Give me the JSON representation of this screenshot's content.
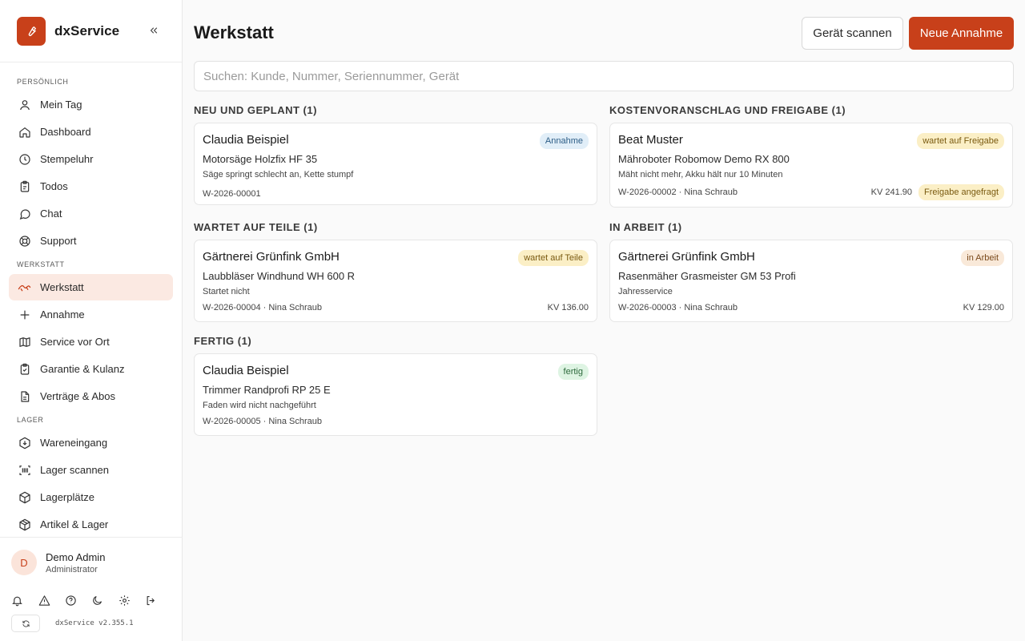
{
  "app": {
    "name": "dxService",
    "version": "dxService v2.355.1"
  },
  "colors": {
    "accent": "#c8401a",
    "active_bg": "#fbe9e2"
  },
  "sidebar": {
    "sections": [
      {
        "label": "PERSÖNLICH",
        "items": [
          {
            "label": "Mein Tag",
            "icon": "user-icon"
          },
          {
            "label": "Dashboard",
            "icon": "home-icon"
          },
          {
            "label": "Stempeluhr",
            "icon": "clock-icon"
          },
          {
            "label": "Todos",
            "icon": "clipboard-icon"
          },
          {
            "label": "Chat",
            "icon": "chat-icon"
          },
          {
            "label": "Support",
            "icon": "lifebuoy-icon"
          }
        ]
      },
      {
        "label": "WERKSTATT",
        "items": [
          {
            "label": "Werkstatt",
            "icon": "wrench-icon",
            "active": true
          },
          {
            "label": "Annahme",
            "icon": "plus-icon"
          },
          {
            "label": "Service vor Ort",
            "icon": "map-icon"
          },
          {
            "label": "Garantie & Kulanz",
            "icon": "clipboard-check-icon"
          },
          {
            "label": "Verträge & Abos",
            "icon": "document-icon"
          }
        ]
      },
      {
        "label": "LAGER",
        "items": [
          {
            "label": "Wareneingang",
            "icon": "download-icon"
          },
          {
            "label": "Lager scannen",
            "icon": "barcode-icon"
          },
          {
            "label": "Lagerplätze",
            "icon": "box-icon"
          },
          {
            "label": "Artikel & Lager",
            "icon": "package-icon"
          }
        ]
      }
    ]
  },
  "user": {
    "initial": "D",
    "name": "Demo Admin",
    "role": "Administrator"
  },
  "tools": [
    "bell-icon",
    "alert-icon",
    "help-icon",
    "moon-icon",
    "gear-icon",
    "logout-icon"
  ],
  "page": {
    "title": "Werkstatt",
    "scan_label": "Gerät scannen",
    "new_label": "Neue Annahme",
    "search_placeholder": "Suchen: Kunde, Nummer, Seriennummer, Gerät"
  },
  "columns": {
    "neu": {
      "title": "NEU UND GEPLANT (1)",
      "card": {
        "name": "Claudia Beispiel",
        "badge": "Annahme",
        "device": "Motorsäge Holzfix HF 35",
        "issue": "Säge springt schlecht an, Kette stumpf",
        "meta": "W-2026-00001",
        "kv": "",
        "extra_badge": ""
      }
    },
    "kv": {
      "title": "KOSTENVORANSCHLAG UND FREIGABE (1)",
      "card": {
        "name": "Beat Muster",
        "badge": "wartet auf Freigabe",
        "device": "Mähroboter Robomow Demo RX 800",
        "issue": "Mäht nicht mehr, Akku hält nur 10 Minuten",
        "meta": "W-2026-00002 · Nina Schraub",
        "kv": "KV 241.90",
        "extra_badge": "Freigabe angefragt"
      }
    },
    "teile": {
      "title": "WARTET AUF TEILE (1)",
      "card": {
        "name": "Gärtnerei Grünfink GmbH",
        "badge": "wartet auf Teile",
        "device": "Laubbläser Windhund WH 600 R",
        "issue": "Startet nicht",
        "meta": "W-2026-00004 · Nina Schraub",
        "kv": "KV 136.00",
        "extra_badge": ""
      }
    },
    "arbeit": {
      "title": "IN ARBEIT (1)",
      "card": {
        "name": "Gärtnerei Grünfink GmbH",
        "badge": "in Arbeit",
        "device": "Rasenmäher Grasmeister GM 53 Profi",
        "issue": "Jahresservice",
        "meta": "W-2026-00003 · Nina Schraub",
        "kv": "KV 129.00",
        "extra_badge": ""
      }
    },
    "fertig": {
      "title": "FERTIG (1)",
      "card": {
        "name": "Claudia Beispiel",
        "badge": "fertig",
        "device": "Trimmer Randprofi RP 25 E",
        "issue": "Faden wird nicht nachgeführt",
        "meta": "W-2026-00005 · Nina Schraub",
        "kv": "",
        "extra_badge": ""
      }
    }
  }
}
